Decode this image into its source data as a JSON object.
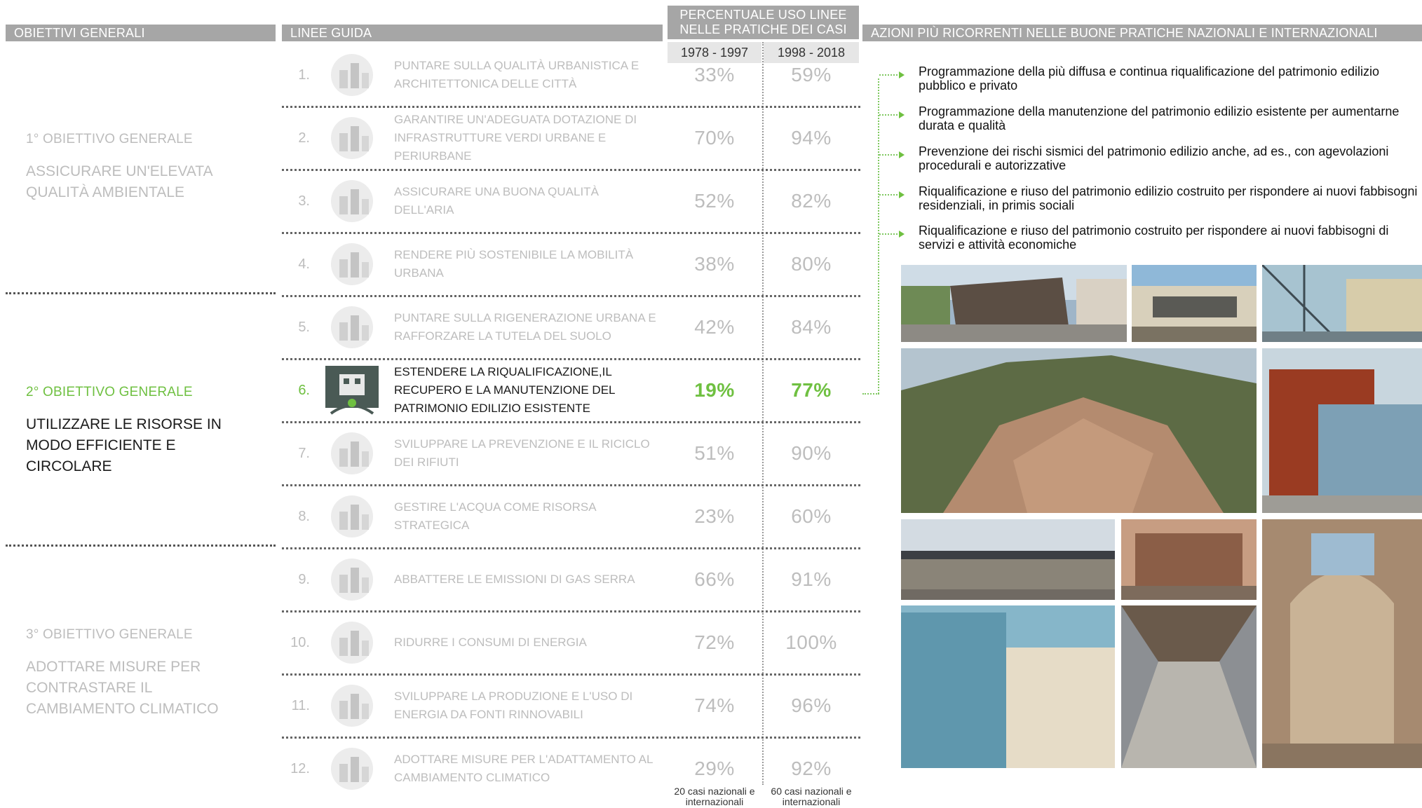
{
  "headers": {
    "objectives": "OBIETTIVI GENERALI",
    "guidelines": "LINEE GUIDA",
    "percent": "PERCENTUALE USO LINEE NELLE PRATICHE DEI CASI",
    "actions": "AZIONI PIÙ RICORRENTI NELLE BUONE PRATICHE NAZIONALI E INTERNAZIONALI"
  },
  "periods": [
    "1978 - 1997",
    "1998 - 2018"
  ],
  "objectives": [
    {
      "title": "1° OBIETTIVO GENERALE",
      "text": "ASSICURARE UN'ELEVATA QUALITÀ AMBIENTALE"
    },
    {
      "title": "2° OBIETTIVO GENERALE",
      "text": "UTILIZZARE LE RISORSE IN MODO EFFICIENTE E CIRCOLARE"
    },
    {
      "title": "3° OBIETTIVO GENERALE",
      "text": "ADOTTARE MISURE PER CONTRASTARE IL CAMBIAMENTO CLIMATICO"
    }
  ],
  "guidelines": [
    {
      "num": "1.",
      "text": "PUNTARE SULLA QUALITÀ URBANISTICA E ARCHITETTONICA DELLE CITTÀ",
      "p1": "33%",
      "p2": "59%",
      "icon": "city-building-icon"
    },
    {
      "num": "2.",
      "text": "GARANTIRE UN'ADEGUATA DOTAZIONE DI INFRASTRUTTURE VERDI URBANE E PERIURBANE",
      "p1": "70%",
      "p2": "94%",
      "icon": "green-landscape-icon"
    },
    {
      "num": "3.",
      "text": "ASSICURARE UNA BUONA QUALITÀ DELL'ARIA",
      "p1": "52%",
      "p2": "82%",
      "icon": "air-quality-icon"
    },
    {
      "num": "4.",
      "text": "RENDERE PIÙ SOSTENIBILE LA MOBILITÀ URBANA",
      "p1": "38%",
      "p2": "80%",
      "icon": "mobility-icon"
    },
    {
      "num": "5.",
      "text": "PUNTARE SULLA RIGENERAZIONE URBANA E RAFFORZARE LA TUTELA DEL SUOLO",
      "p1": "42%",
      "p2": "84%",
      "icon": "regeneration-icon"
    },
    {
      "num": "6.",
      "text": "ESTENDERE LA RIQUALIFICAZIONE,IL RECUPERO E LA MANUTENZIONE DEL PATRIMONIO EDILIZIO ESISTENTE",
      "p1": "19%",
      "p2": "77%",
      "icon": "building-heritage-icon"
    },
    {
      "num": "7.",
      "text": "SVILUPPARE LA PREVENZIONE E IL RICICLO DEI RIFIUTI",
      "p1": "51%",
      "p2": "90%",
      "icon": "recycle-icon"
    },
    {
      "num": "8.",
      "text": "GESTIRE L'ACQUA COME RISORSA STRATEGICA",
      "p1": "23%",
      "p2": "60%",
      "icon": "water-icon"
    },
    {
      "num": "9.",
      "text": "ABBATTERE LE EMISSIONI DI GAS SERRA",
      "p1": "66%",
      "p2": "91%",
      "icon": "globe-emissions-icon"
    },
    {
      "num": "10.",
      "text": "RIDURRE I CONSUMI DI ENERGIA",
      "p1": "72%",
      "p2": "100%",
      "icon": "energy-house-icon"
    },
    {
      "num": "11.",
      "text": "SVILUPPARE LA PRODUZIONE E L'USO DI ENERGIA DA FONTI RINNOVABILI",
      "p1": "74%",
      "p2": "96%",
      "icon": "renewable-energy-icon"
    },
    {
      "num": "12.",
      "text": "ADOTTARE MISURE PER L'ADATTAMENTO AL CAMBIAMENTO CLIMATICO",
      "p1": "29%",
      "p2": "92%",
      "icon": "climate-adaptation-icon"
    }
  ],
  "footnotes": [
    "20 casi nazionali e internazionali",
    "60 casi nazionali e internazionali"
  ],
  "actions": [
    "Programmazione della più diffusa e continua riqualificazione del patrimonio edilizio pubblico e privato",
    "Programmazione della manutenzione del patrimonio edilizio esistente per aumentarne durata e qualità",
    "Prevenzione dei rischi sismici del patrimonio edilizio anche, ad es., con agevolazioni procedurali e autorizzative",
    "Riqualificazione e riuso del patrimonio edilizio costruito per rispondere ai nuovi fabbisogni residenziali, in primis sociali",
    "Riqualificazione e riuso del patrimonio costruito per rispondere ai nuovi fabbisogni di servizi e attività economiche"
  ],
  "colors": {
    "accent": "#6fc041",
    "header": "#a6a6a6",
    "muted": "#bdbdbd"
  }
}
